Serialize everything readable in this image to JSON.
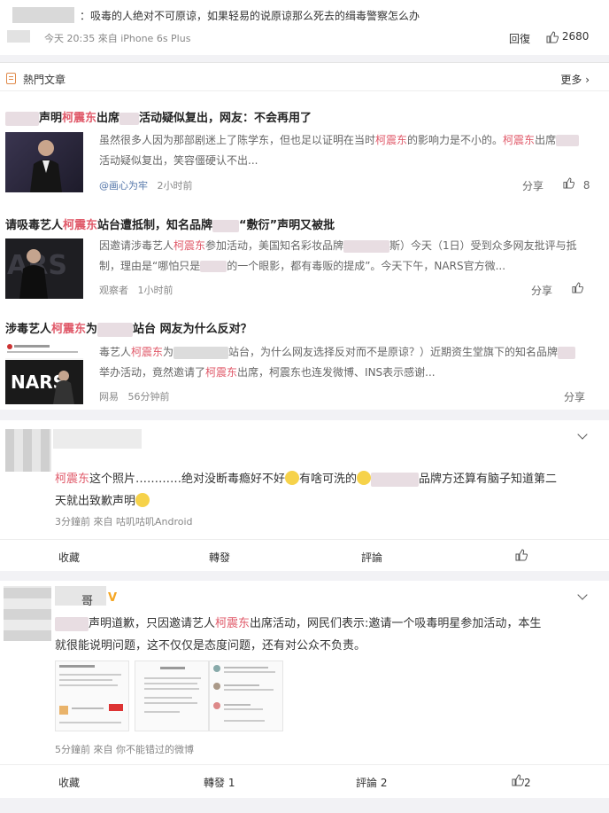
{
  "top_comment": {
    "text": "：吸毒的人绝对不可原谅，如果轻易的说原谅那么死去的缉毒警察怎么办",
    "meta": "今天 20:35 來自 iPhone 6s Plus",
    "reply_label": "回復",
    "like_count": "2680"
  },
  "hot": {
    "title": "熱門文章",
    "more": "更多",
    "articles": [
      {
        "title_pre": "声明",
        "title_name": "柯震东",
        "title_mid": "出席",
        "title_post": "活动疑似复出，网友：不会再用了",
        "summary_1": "虽然很多人因为那部剧迷上了陈学东，但也足以证明在当时",
        "summary_name1": "柯震东",
        "summary_2": "的影响力是不小的。",
        "summary_name2": "柯震东",
        "summary_3": "出席",
        "summary_4": "活动疑似复出，笑容僵硬认不出...",
        "source": "@画心为牢",
        "time": "2小时前",
        "share": "分享",
        "likes": "8"
      },
      {
        "title_pre": "请吸毒艺人",
        "title_name": "柯震东",
        "title_mid": "站台遭抵制，知名品牌",
        "title_post": "“敷衍”声明又被批",
        "summary_1": "因邀请涉毒艺人",
        "summary_name1": "柯震东",
        "summary_2": "参加活动，美国知名彩妆品牌",
        "summary_3": "斯）今天（1日）受到众多网友批评与抵",
        "summary_4": "制，理由是“哪怕只是",
        "summary_5": "的一个眼影，都有毒贩的提成”。今天下午，NARS官方微...",
        "source": "观察者",
        "time": "1小时前",
        "share": "分享"
      },
      {
        "title_pre": "涉毒艺人",
        "title_name": "柯震东",
        "title_mid": "为",
        "title_post": "站台 网友为什么反对？",
        "summary_1": "毒艺人",
        "summary_name1": "柯震东",
        "summary_2": "为",
        "summary_3": "站台，为什么网友选择反对而不是原谅？）近期资生堂旗下的知名品牌",
        "summary_4": "举办活动，竟然邀请了",
        "summary_name2": "柯震东",
        "summary_5": "出席，柯震东也连发微博、INS表示感谢...",
        "source": "网易",
        "time": "56分钟前",
        "share": "分享",
        "thumb_logo": "NARS"
      }
    ]
  },
  "comment1": {
    "name": "柯震东",
    "text_1": "这个照片…………绝对没断毒瘾好不好",
    "text_2": "有啥可洗的",
    "text_3": "品牌方还算有脑子知道第二",
    "text_4": "天就出致歉声明",
    "meta": "3分鐘前 來自 咕叽咕叽Android",
    "actions": {
      "collect": "收藏",
      "repost": "轉發",
      "comment": "評論"
    }
  },
  "comment2": {
    "name_suffix": "哥",
    "verified": "V",
    "text_1": "声明道歉，只因邀请艺人",
    "name": "柯震东",
    "text_2": "出席活动，网民们表示:邀请一个吸毒明星参加活动，本生",
    "text_3": "就很能说明问题，这不仅仅是态度问题，还有对公众不负责。",
    "meta": "5分鐘前 來自 你不能错过的微博",
    "actions": {
      "collect": "收藏",
      "repost": "轉發 1",
      "comment": "評論 2",
      "like": "2"
    }
  },
  "colors": {
    "accent_red": "#e05a6a",
    "verified": "#f5a623"
  }
}
